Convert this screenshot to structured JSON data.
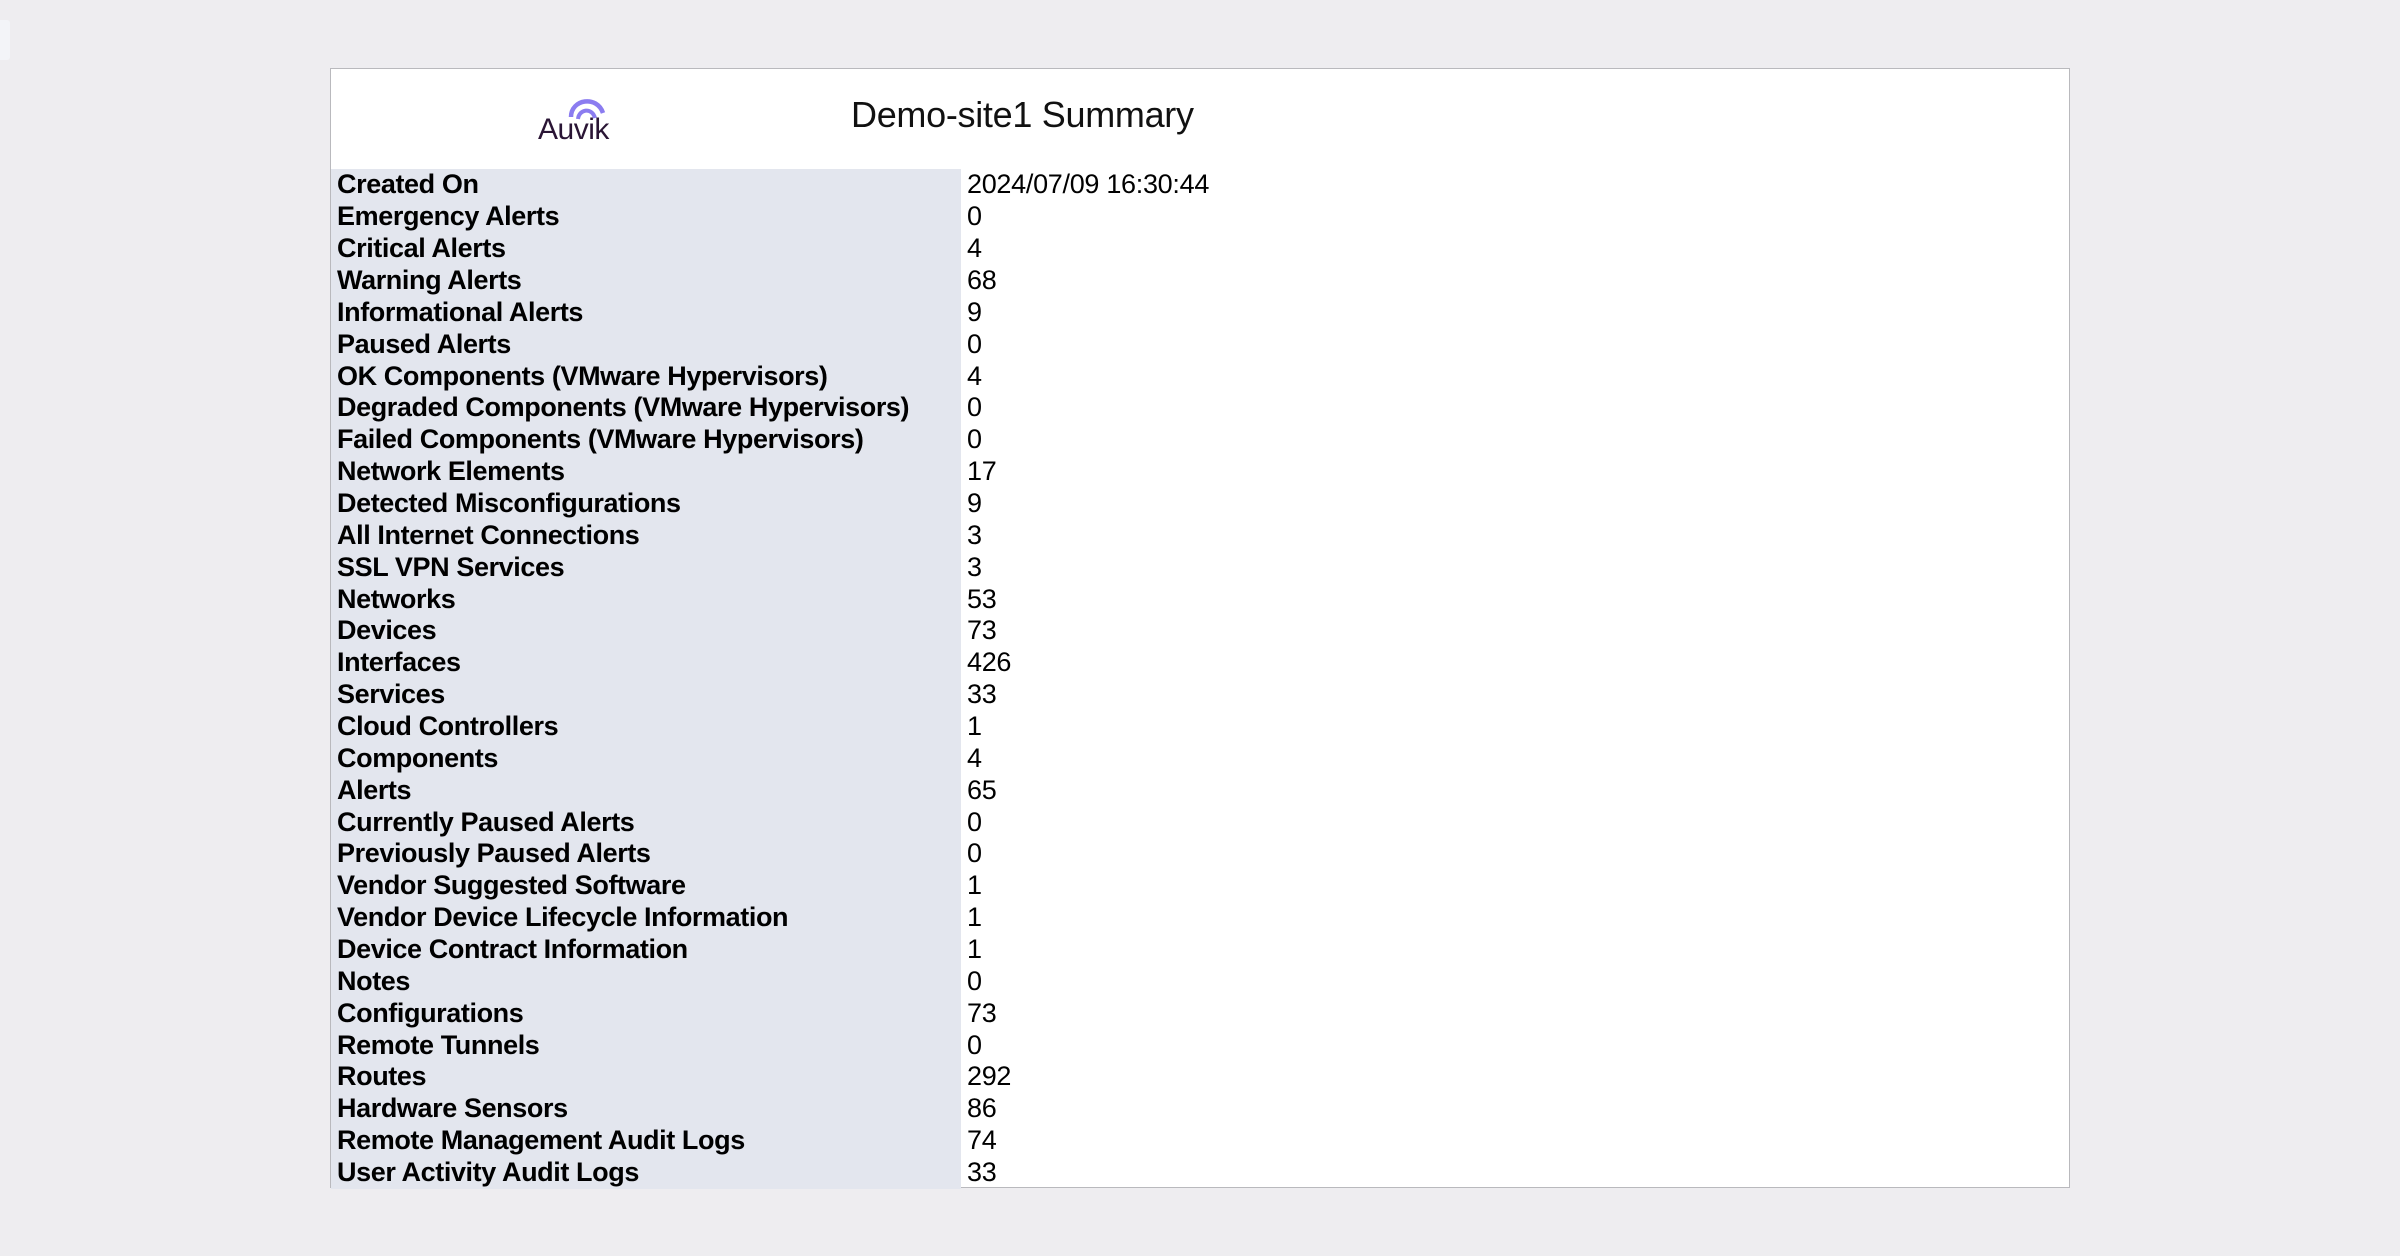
{
  "report": {
    "logo": {
      "text": "Auvik",
      "icon": "auvik-arcs-logo",
      "text_color": "#2a1535",
      "arc_color": "#8b7cf0"
    },
    "title": "Demo-site1 Summary",
    "rows": [
      {
        "label": "Created On",
        "value": "2024/07/09 16:30:44"
      },
      {
        "label": "Emergency Alerts",
        "value": "0"
      },
      {
        "label": "Critical Alerts",
        "value": "4"
      },
      {
        "label": "Warning Alerts",
        "value": "68"
      },
      {
        "label": "Informational Alerts",
        "value": "9"
      },
      {
        "label": "Paused Alerts",
        "value": "0"
      },
      {
        "label": "OK Components (VMware Hypervisors)",
        "value": "4"
      },
      {
        "label": "Degraded Components (VMware Hypervisors)",
        "value": "0"
      },
      {
        "label": "Failed Components (VMware Hypervisors)",
        "value": "0"
      },
      {
        "label": "Network Elements",
        "value": "17"
      },
      {
        "label": "Detected Misconfigurations",
        "value": "9"
      },
      {
        "label": "All Internet Connections",
        "value": "3"
      },
      {
        "label": "SSL VPN Services",
        "value": "3"
      },
      {
        "label": "Networks",
        "value": "53"
      },
      {
        "label": "Devices",
        "value": "73"
      },
      {
        "label": "Interfaces",
        "value": "426"
      },
      {
        "label": "Services",
        "value": "33"
      },
      {
        "label": "Cloud Controllers",
        "value": "1"
      },
      {
        "label": "Components",
        "value": "4"
      },
      {
        "label": "Alerts",
        "value": "65"
      },
      {
        "label": "Currently Paused Alerts",
        "value": "0"
      },
      {
        "label": "Previously Paused Alerts",
        "value": "0"
      },
      {
        "label": "Vendor Suggested Software",
        "value": "1"
      },
      {
        "label": "Vendor Device Lifecycle Information",
        "value": "1"
      },
      {
        "label": "Device Contract Information",
        "value": "1"
      },
      {
        "label": "Notes",
        "value": "0"
      },
      {
        "label": "Configurations",
        "value": "73"
      },
      {
        "label": "Remote Tunnels",
        "value": "0"
      },
      {
        "label": "Routes",
        "value": "292"
      },
      {
        "label": "Hardware Sensors",
        "value": "86"
      },
      {
        "label": "Remote Management Audit Logs",
        "value": "74"
      },
      {
        "label": "User Activity Audit Logs",
        "value": "33"
      }
    ]
  }
}
